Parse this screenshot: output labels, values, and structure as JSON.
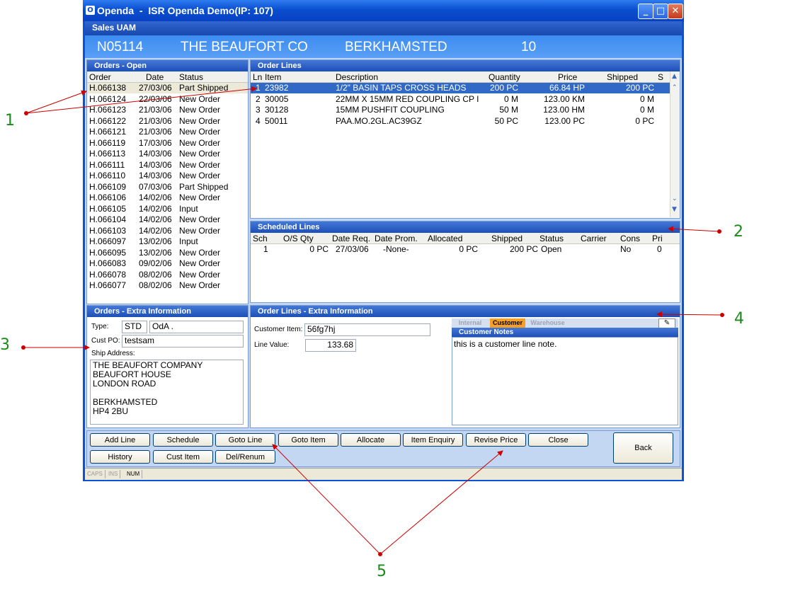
{
  "window": {
    "title": "Openda  -  ISR Openda Demo(IP: 107)",
    "icon": "openda-app-icon"
  },
  "menu": {
    "label": "Sales UAM"
  },
  "info": {
    "account": "N05114",
    "name": "THE BEAUFORT CO",
    "town": "BERKHAMSTED",
    "number": "10"
  },
  "orders_open": {
    "title": "Orders - Open",
    "headers": [
      "Order",
      "Date",
      "Status"
    ],
    "rows": [
      [
        "H.066138",
        "27/03/06",
        "Part Shipped"
      ],
      [
        "H.066124",
        "22/03/06",
        "New Order"
      ],
      [
        "H.066123",
        "21/03/06",
        "New Order"
      ],
      [
        "H.066122",
        "21/03/06",
        "New Order"
      ],
      [
        "H.066121",
        "21/03/06",
        "New Order"
      ],
      [
        "H.066119",
        "17/03/06",
        "New Order"
      ],
      [
        "H.066113",
        "14/03/06",
        "New Order"
      ],
      [
        "H.066111",
        "14/03/06",
        "New Order"
      ],
      [
        "H.066110",
        "14/03/06",
        "New Order"
      ],
      [
        "H.066109",
        "07/03/06",
        "Part Shipped"
      ],
      [
        "H.066106",
        "14/02/06",
        "New Order"
      ],
      [
        "H.066105",
        "14/02/06",
        "Input"
      ],
      [
        "H.066104",
        "14/02/06",
        "New Order"
      ],
      [
        "H.066103",
        "14/02/06",
        "New Order"
      ],
      [
        "H.066097",
        "13/02/06",
        "Input"
      ],
      [
        "H.066095",
        "13/02/06",
        "New Order"
      ],
      [
        "H.066083",
        "09/02/06",
        "New Order"
      ],
      [
        "H.066078",
        "08/02/06",
        "New Order"
      ],
      [
        "H.066077",
        "08/02/06",
        "New Order"
      ]
    ]
  },
  "order_lines": {
    "title": "Order Lines",
    "headers": [
      "Ln",
      "Item",
      "Description",
      "Quantity",
      "Price",
      "Shipped",
      "S"
    ],
    "rows": [
      [
        "1",
        "23982",
        "1/2\" BASIN TAPS CROSS HEADS",
        "200 PC",
        "66.84 HP",
        "200 PC"
      ],
      [
        "2",
        "30005",
        "22MM X 15MM RED COUPLING CP I",
        "0 M",
        "123.00 KM",
        "0 M"
      ],
      [
        "3",
        "30128",
        "15MM PUSHFIT COUPLING",
        "50 M",
        "123.00 HM",
        "0 M"
      ],
      [
        "4",
        "50011",
        "PAA.MO.2GL.AC39GZ",
        "50 PC",
        "123.00 PC",
        "0 PC"
      ]
    ]
  },
  "scheduled_lines": {
    "title": "Scheduled Lines",
    "headers": [
      "Sch",
      "O/S Qty",
      "Date Req.",
      "Date Prom.",
      "Allocated",
      "Shipped",
      "Status",
      "Carrier",
      "Cons",
      "Pri"
    ],
    "rows": [
      [
        "1",
        "0 PC",
        "27/03/06",
        "-None-",
        "0 PC",
        "200 PC",
        "Open",
        "",
        "No",
        "0"
      ]
    ]
  },
  "orders_extra": {
    "title": "Orders - Extra Information",
    "type_label": "Type:",
    "type_value": "STD",
    "type_extra": "OdA .",
    "custpo_label": "Cust PO:",
    "custpo_value": "testsam",
    "ship_label": "Ship Address:",
    "address": [
      "THE BEAUFORT COMPANY",
      "BEAUFORT HOUSE",
      "LONDON ROAD",
      "",
      "BERKHAMSTED",
      "HP4 2BU"
    ]
  },
  "lines_extra": {
    "title": "Order Lines - Extra Information",
    "cust_item_label": "Customer Item:",
    "cust_item_value": "56fg7hj",
    "line_value_label": "Line Value:",
    "line_value": "133.68",
    "tabs": [
      "Internal",
      "Customer",
      "Warehouse"
    ],
    "notes_title": "Customer Notes",
    "notes": "this is a customer line note."
  },
  "buttons": {
    "add_line": "Add Line",
    "schedule": "Schedule",
    "goto_line": "Goto Line",
    "goto_item": "Goto Item",
    "allocate": "Allocate",
    "item_enquiry": "Item Enquiry",
    "revise_price": "Revise Price",
    "close": "Close",
    "back": "Back",
    "history": "History",
    "cust_item": "Cust Item",
    "del_renum": "Del/Renum"
  },
  "status": {
    "caps": "CAPS",
    "ins": "INS",
    "num": "NUM"
  },
  "annotations": {
    "a1": "1",
    "a2": "2",
    "a3": "3",
    "a4": "4",
    "a5": "5"
  },
  "colors": {
    "title_blue": "#0a4fd0",
    "panel_head": "#1d4fb8",
    "selection": "#3169c6",
    "annotation_green": "#1a8a1a",
    "arrow_red": "#cc0000"
  }
}
